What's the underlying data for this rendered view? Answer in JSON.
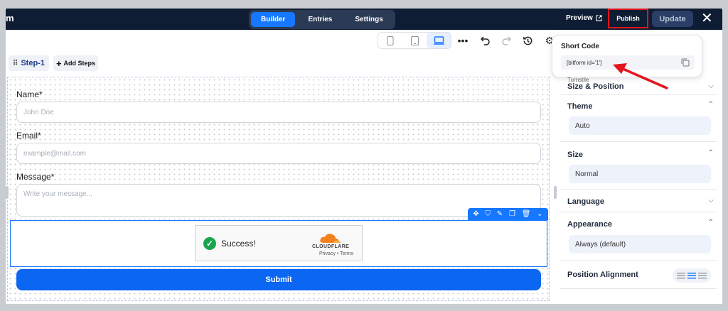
{
  "topbar": {
    "brand": "m",
    "tabs": [
      {
        "label": "Builder",
        "active": true
      },
      {
        "label": "Entries",
        "active": false
      },
      {
        "label": "Settings",
        "active": false
      }
    ],
    "preview_label": "Preview",
    "publish_label": "Publish",
    "update_label": "Update",
    "close_icon": "close-icon"
  },
  "toolbar": {
    "devices": [
      "mobile-icon",
      "tablet-icon",
      "desktop-icon"
    ],
    "active_device": "desktop",
    "tools": [
      "more-icon",
      "undo-icon",
      "redo-icon",
      "history-icon",
      "gear-icon"
    ]
  },
  "steps": {
    "current": "Step-1",
    "add_label": "Add Steps"
  },
  "form": {
    "name_label": "Name*",
    "name_placeholder": "John Doe",
    "email_label": "Email*",
    "email_placeholder": "example@mail.com",
    "message_label": "Message*",
    "message_placeholder": "Write your message...",
    "turnstile": {
      "status": "Success!",
      "brand": "CLOUDFLARE",
      "links": "Privacy  •  Terms"
    },
    "submit_label": "Submit"
  },
  "popover": {
    "title": "Short Code",
    "code": "[bitform id='1']"
  },
  "panel": {
    "partial_label": "Turnstile",
    "size_position": "Size & Position",
    "theme_title": "Theme",
    "theme_value": "Auto",
    "size_title": "Size",
    "size_value": "Normal",
    "language_title": "Language",
    "appearance_title": "Appearance",
    "appearance_value": "Always (default)",
    "position_title": "Position Alignment"
  },
  "colors": {
    "topbar": "#0e1c34",
    "accent": "#1677ff",
    "highlight": "#e2151d",
    "success": "#1aa54b"
  }
}
